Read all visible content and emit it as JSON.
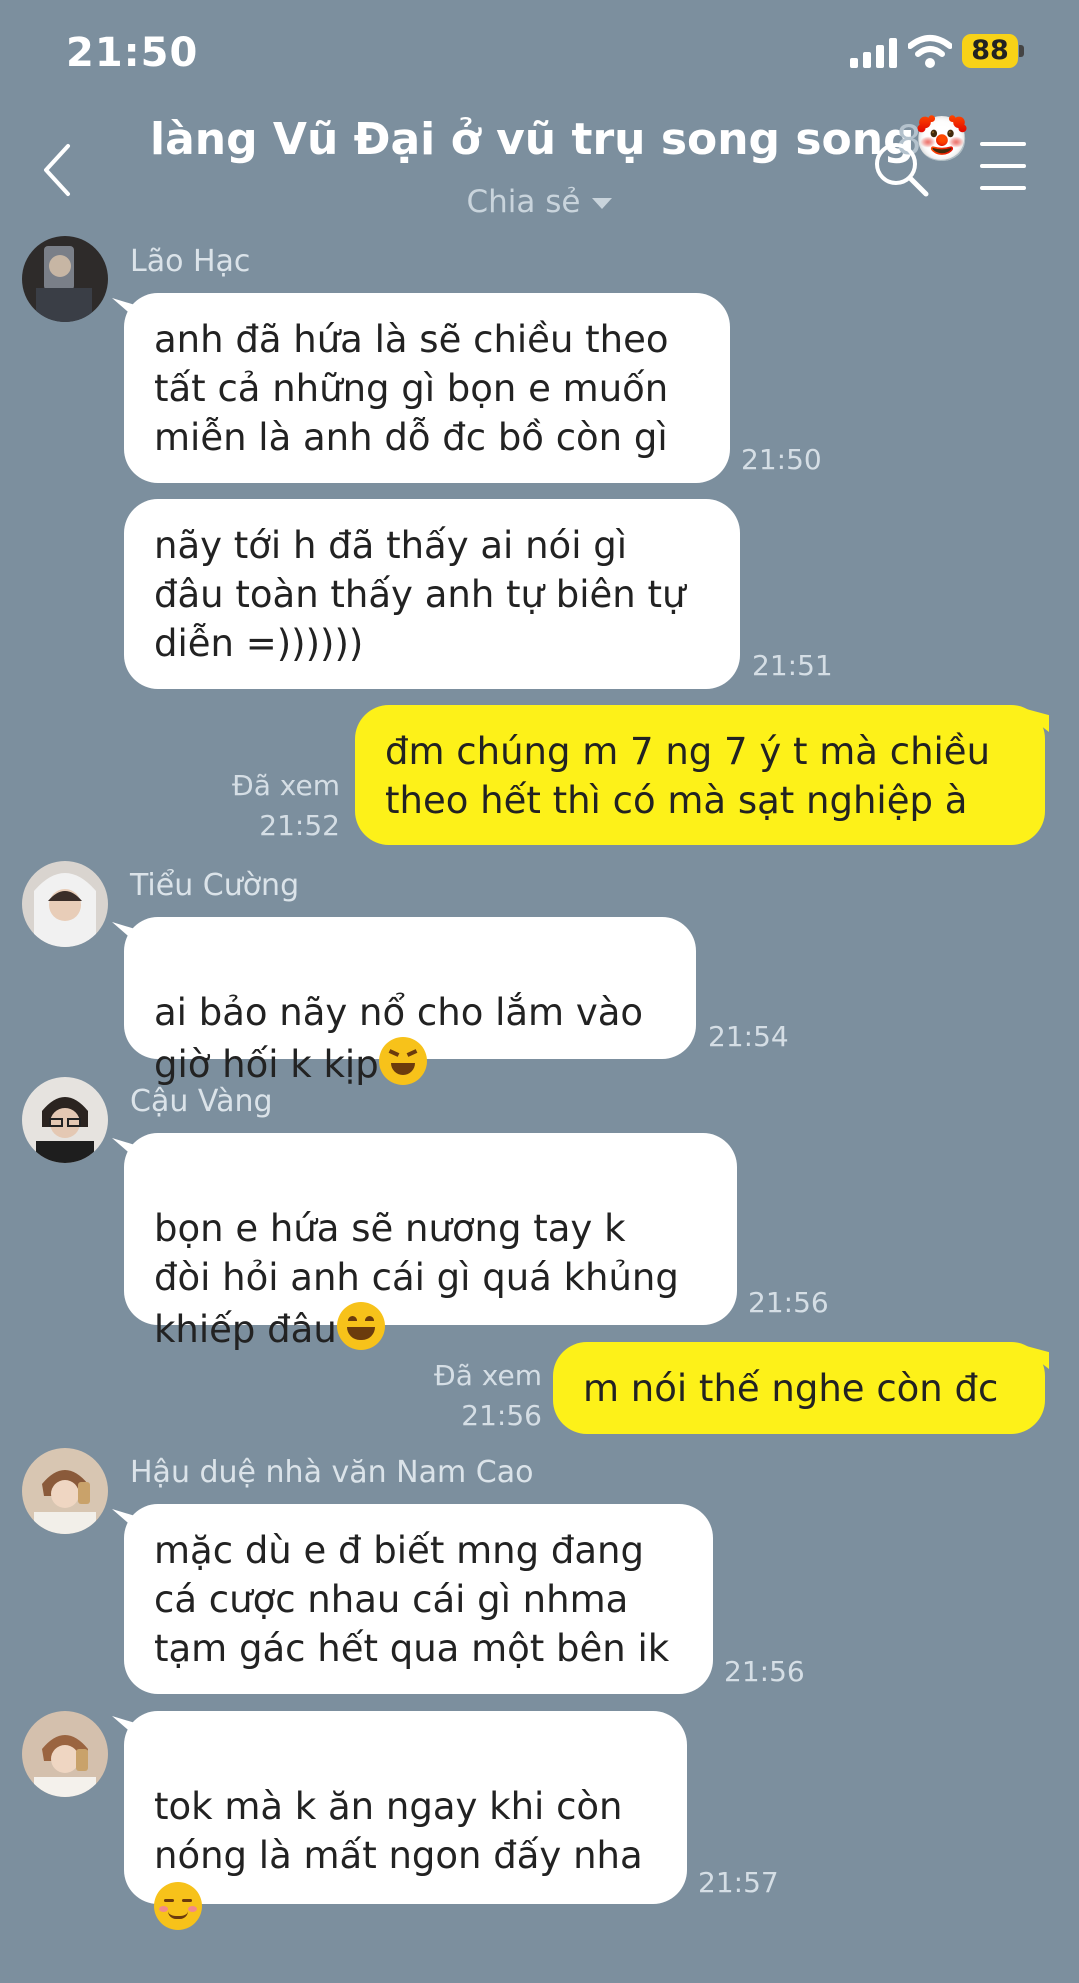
{
  "status": {
    "time": "21:50",
    "battery": "88"
  },
  "header": {
    "title": "làng Vũ Đại ở vũ trụ song song🤡",
    "member_count": "8",
    "subtitle": "Chia sẻ"
  },
  "messages": [
    {
      "sender": "Lão Hạc",
      "lines": "anh đã hứa là sẽ chiều theo\ntất cả những gì bọn e muốn\nmiễn là anh dỗ đc bồ còn gì",
      "time": "21:50"
    },
    {
      "lines": "nãy tới h đã thấy ai nói gì\nđâu toàn thấy anh tự biên tự\ndiễn =))))))",
      "time": "21:51"
    },
    {
      "seen": "Đã xem",
      "time": "21:52",
      "lines": "đm chúng m 7 ng 7 ý t mà chiều\ntheo hết thì có mà sạt nghiệp à"
    },
    {
      "sender": "Tiểu Cường",
      "lines": "ai bảo nãy nổ cho lắm vào\ngiờ hối k kịp",
      "time": "21:54"
    },
    {
      "sender": "Cậu Vàng",
      "lines": "bọn e hứa sẽ nương tay k\nđòi hỏi anh cái gì quá khủng\nkhiếp đâu",
      "time": "21:56"
    },
    {
      "seen": "Đã xem",
      "time": "21:56",
      "lines": "m nói thế nghe còn đc"
    },
    {
      "sender": "Hậu duệ nhà văn Nam Cao",
      "lines": "mặc dù e đ biết mng đang\ncá cược nhau cái gì nhma\ntạm gác hết qua một bên ik",
      "time": "21:56"
    },
    {
      "lines": "tok mà k ăn ngay khi còn\nnóng là mất ngon đấy nha",
      "time": "21:57"
    }
  ],
  "emojis": {
    "m3": "grinning-squinting-face-emoji",
    "m4": "beaming-face-emoji",
    "m7": "smiling-face-emoji"
  },
  "colors": {
    "background": "#7c8f9e",
    "outgoing": "#fdf119",
    "incoming": "#ffffff"
  }
}
